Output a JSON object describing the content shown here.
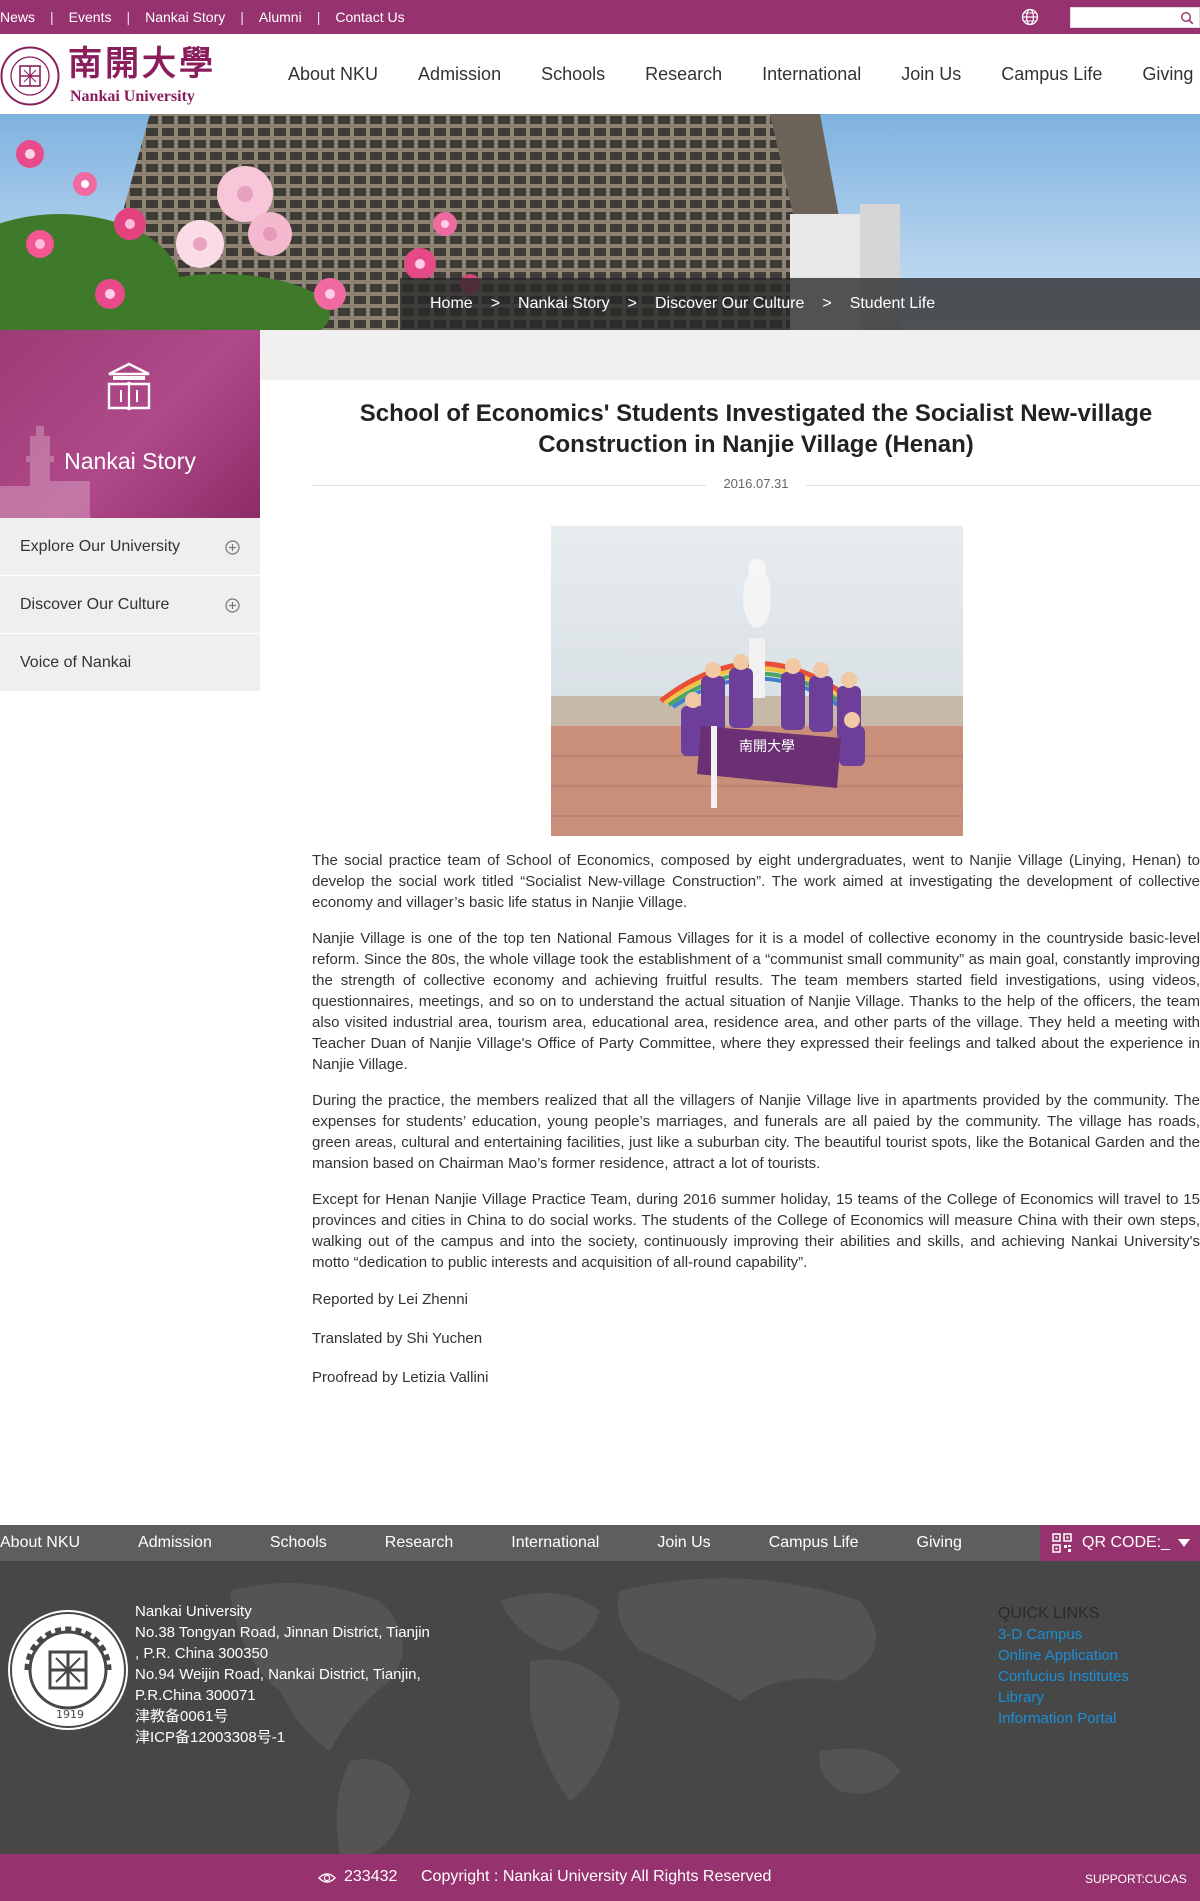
{
  "topbar": {
    "links": [
      "News",
      "Events",
      "Nankai Story",
      "Alumni",
      "Contact Us"
    ],
    "search_placeholder": ""
  },
  "header": {
    "logo_cn": "南開大學",
    "logo_en": "Nankai University",
    "nav": [
      "About NKU",
      "Admission",
      "Schools",
      "Research",
      "International",
      "Join Us",
      "Campus Life",
      "Giving"
    ]
  },
  "breadcrumb": {
    "home": "Home",
    "sep": ">",
    "level1": "Nankai Story",
    "level2": "Discover Our Culture",
    "current": "Student Life"
  },
  "sidebar": {
    "title": "Nankai Story",
    "items": [
      {
        "label": "Explore Our University",
        "expandable": true
      },
      {
        "label": "Discover Our Culture",
        "expandable": true
      },
      {
        "label": "Voice of Nankai",
        "expandable": false
      }
    ]
  },
  "article": {
    "title": "School of Economics' Students Investigated the Socialist New-village Construction in Nanjie Village (Henan)",
    "date": "2016.07.31",
    "photo_banner_text": "南開大學",
    "paragraphs": [
      "The social practice team of School of Economics, composed by eight undergraduates, went to Nanjie Village (Linying, Henan) to develop the social work titled “Socialist New-village Construction”. The work aimed at investigating the development of collective economy and villager’s basic life status in Nanjie Village.",
      "Nanjie Village is one of the top ten National Famous Villages for it is a model of collective economy in the countryside basic-level reform. Since the 80s, the whole village took the establishment of a “communist small community” as main goal, constantly improving the strength of collective economy and achieving fruitful results. The team members started field investigations, using videos, questionnaires, meetings, and so on to understand the actual situation of Nanjie Village. Thanks to the help of the officers, the team also visited industrial area, tourism area, educational area, residence area, and other parts of the village. They held a meeting with Teacher Duan of Nanjie Village's Office of Party Committee, where they expressed their feelings and talked about the experience in Nanjie Village.",
      "During the practice, the members realized that all the villagers of Nanjie Village live in apartments provided by the community. The expenses for students’ education, young people’s marriages, and funerals are all paied by the community. The village has roads, green areas, cultural and entertaining facilities, just like a suburban city. The beautiful tourist spots, like the Botanical Garden and the mansion based on Chairman Mao’s former residence, attract a lot of tourists.",
      "Except for Henan Nanjie Village Practice Team, during 2016 summer holiday, 15 teams of the College of Economics will travel to 15 provinces and cities in China to do social works. The students of the College of Economics will measure China with their own steps, walking out of the campus and into the society, continuously improving their abilities and skills, and achieving Nankai University's motto “dedication to public interests and acquisition of all-round capability”."
    ],
    "credits": [
      "Reported by Lei Zhenni",
      "Translated by Shi Yuchen",
      "Proofread by Letizia Vallini"
    ]
  },
  "footer": {
    "nav": [
      "About NKU",
      "Admission",
      "Schools",
      "Research",
      "International",
      "Join Us",
      "Campus Life",
      "Giving"
    ],
    "qr_label": "QR CODE:_",
    "address_lines": [
      "Nankai University",
      "No.38 Tongyan Road, Jinnan District, Tianjin",
      ", P.R. China 300350",
      "No.94 Weijin Road,  Nankai District, Tianjin,",
      "P.R.China  300071",
      "津教备0061号",
      "津ICP备12003308号-1"
    ],
    "quick_links_heading": "QUICK LINKS",
    "quick_links": [
      "3-D Campus",
      "Online Application",
      "Confucius Institutes",
      "Library",
      "Information Portal"
    ],
    "visits": "233432",
    "copyright": "Copyright : Nankai University All Rights Reserved",
    "support": "SUPPORT:CUCAS"
  },
  "colors": {
    "brand": "#96336e",
    "footer_nav_bg": "#5e5e5e",
    "footer_bg": "#474747",
    "link_blue": "#1a8fd6"
  },
  "icons": {
    "globe": "globe-icon",
    "search": "search-icon",
    "plus": "circle-plus-icon",
    "book": "book-icon",
    "qr": "qr-code-icon",
    "eye": "eye-icon"
  }
}
